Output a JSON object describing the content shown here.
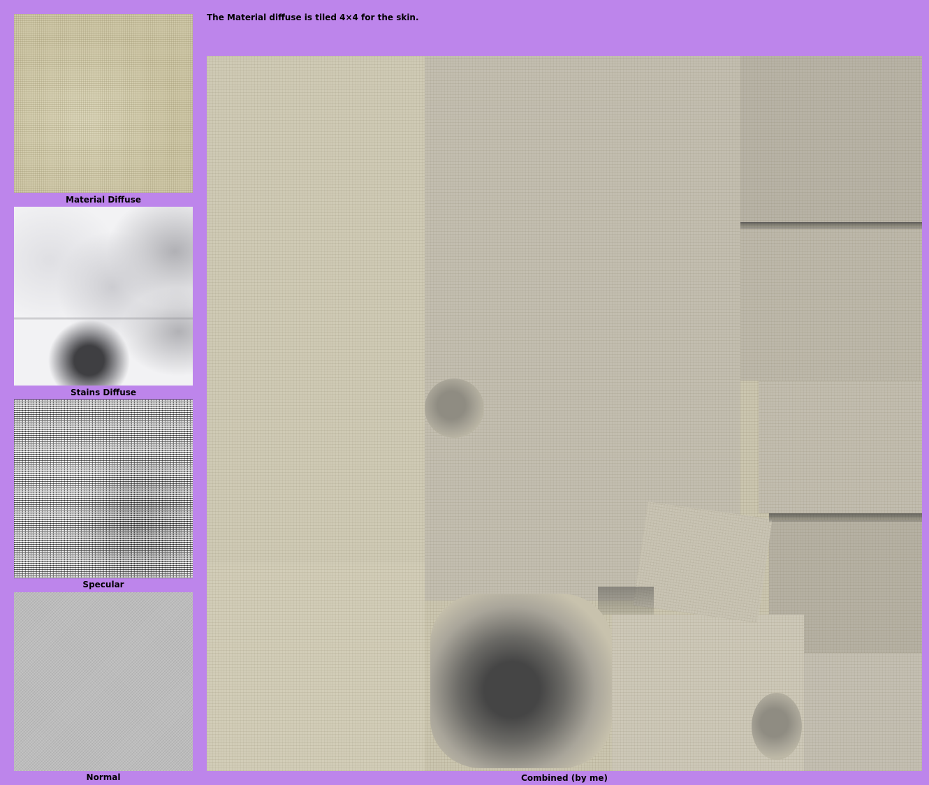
{
  "panels": [
    {
      "label": "Material Diffuse",
      "texture": "linen-beige"
    },
    {
      "label": "Stains Diffuse",
      "texture": "stain-atlas-grayscale"
    },
    {
      "label": "Specular",
      "texture": "noise-black-white"
    },
    {
      "label": "Normal",
      "texture": "weave-gray"
    }
  ],
  "note": "The Material diffuse is tiled 4×4 for the skin.",
  "combined": {
    "label": "Combined (by me)",
    "texture": "linen-with-stains"
  },
  "colors": {
    "background": "#bd85eb",
    "text": "#000000"
  }
}
